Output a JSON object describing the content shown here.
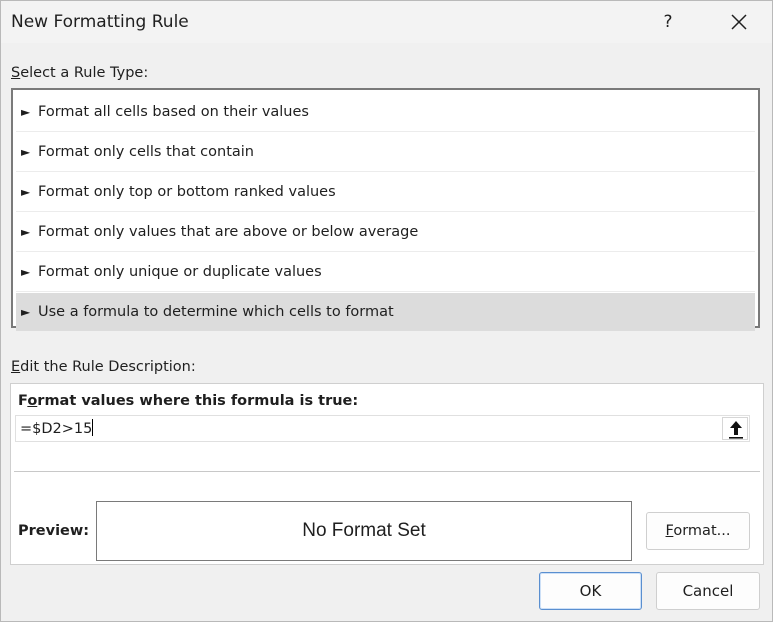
{
  "dialog": {
    "title": "New Formatting Rule",
    "help_label": "?",
    "close_label": "✕"
  },
  "rule_type": {
    "label_prefix": "S",
    "label_rest": "elect a Rule Type:",
    "items": [
      {
        "label": "Format all cells based on their values",
        "selected": false
      },
      {
        "label": "Format only cells that contain",
        "selected": false
      },
      {
        "label": "Format only top or bottom ranked values",
        "selected": false
      },
      {
        "label": "Format only values that are above or below average",
        "selected": false
      },
      {
        "label": "Format only unique or duplicate values",
        "selected": false
      },
      {
        "label": "Use a formula to determine which cells to format",
        "selected": true
      }
    ]
  },
  "description": {
    "label_prefix": "E",
    "label_rest": "dit the Rule Description:",
    "formula_label_pre": "F",
    "formula_label_accel": "o",
    "formula_label_post": "rmat values where this formula is true:",
    "formula_value": "=$D2>15",
    "preview_label": "Preview:",
    "preview_text": "No Format Set",
    "format_button_accel": "F",
    "format_button_rest": "ormat..."
  },
  "footer": {
    "ok_label": "OK",
    "cancel_label": "Cancel"
  }
}
